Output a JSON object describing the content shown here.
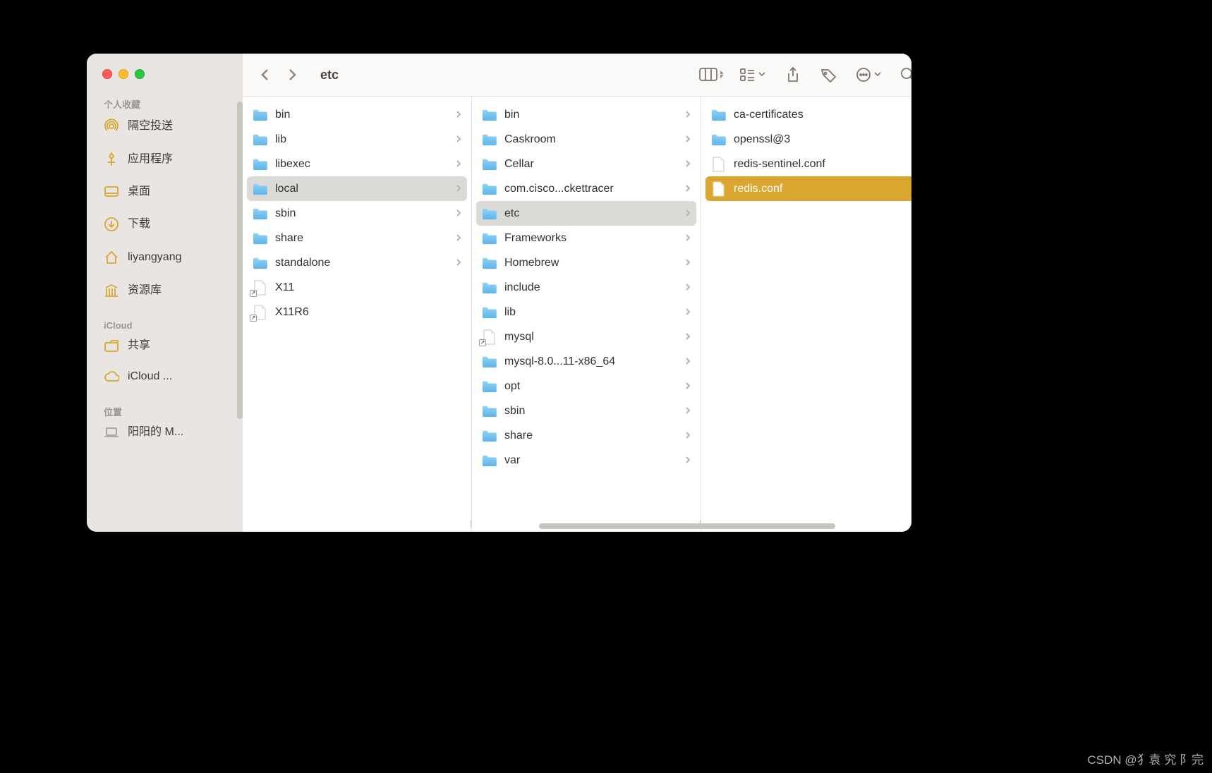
{
  "window_title": "etc",
  "sidebar": {
    "sections": [
      {
        "header": "个人收藏",
        "items": [
          {
            "icon": "airdrop",
            "label": "隔空投送"
          },
          {
            "icon": "apps",
            "label": "应用程序"
          },
          {
            "icon": "desktop",
            "label": "桌面"
          },
          {
            "icon": "downloads",
            "label": "下载"
          },
          {
            "icon": "home",
            "label": "liyangyang"
          },
          {
            "icon": "library",
            "label": "资源库"
          }
        ]
      },
      {
        "header": "iCloud",
        "items": [
          {
            "icon": "shared",
            "label": "共享"
          },
          {
            "icon": "icloud",
            "label": "iCloud ..."
          }
        ]
      },
      {
        "header": "位置",
        "items": [
          {
            "icon": "laptop",
            "label": "阳阳的 M..."
          }
        ]
      }
    ]
  },
  "columns": [
    {
      "items": [
        {
          "type": "folder",
          "name": "bin",
          "has_children": true
        },
        {
          "type": "folder",
          "name": "lib",
          "has_children": true
        },
        {
          "type": "folder",
          "name": "libexec",
          "has_children": true
        },
        {
          "type": "folder",
          "name": "local",
          "has_children": true,
          "selected": "gray"
        },
        {
          "type": "folder",
          "name": "sbin",
          "has_children": true
        },
        {
          "type": "folder",
          "name": "share",
          "has_children": true
        },
        {
          "type": "folder",
          "name": "standalone",
          "has_children": true
        },
        {
          "type": "alias",
          "name": "X11"
        },
        {
          "type": "alias",
          "name": "X11R6"
        }
      ]
    },
    {
      "items": [
        {
          "type": "folder",
          "name": "bin",
          "has_children": true
        },
        {
          "type": "folder",
          "name": "Caskroom",
          "has_children": true
        },
        {
          "type": "folder",
          "name": "Cellar",
          "has_children": true
        },
        {
          "type": "folder",
          "name": "com.cisco...ckettracer",
          "has_children": true
        },
        {
          "type": "folder",
          "name": "etc",
          "has_children": true,
          "selected": "gray"
        },
        {
          "type": "folder",
          "name": "Frameworks",
          "has_children": true
        },
        {
          "type": "folder",
          "name": "Homebrew",
          "has_children": true
        },
        {
          "type": "folder",
          "name": "include",
          "has_children": true
        },
        {
          "type": "folder",
          "name": "lib",
          "has_children": true
        },
        {
          "type": "alias",
          "name": "mysql",
          "has_children": true
        },
        {
          "type": "folder",
          "name": "mysql-8.0...11-x86_64",
          "has_children": true
        },
        {
          "type": "folder",
          "name": "opt",
          "has_children": true
        },
        {
          "type": "folder",
          "name": "sbin",
          "has_children": true
        },
        {
          "type": "folder",
          "name": "share",
          "has_children": true
        },
        {
          "type": "folder",
          "name": "var",
          "has_children": true
        }
      ]
    },
    {
      "items": [
        {
          "type": "folder",
          "name": "ca-certificates",
          "has_children": true
        },
        {
          "type": "folder",
          "name": "openssl@3",
          "has_children": true
        },
        {
          "type": "file",
          "name": "redis-sentinel.conf"
        },
        {
          "type": "file",
          "name": "redis.conf",
          "selected": "gold"
        }
      ]
    }
  ],
  "watermark": "CSDN @犭袁 究 阝完"
}
